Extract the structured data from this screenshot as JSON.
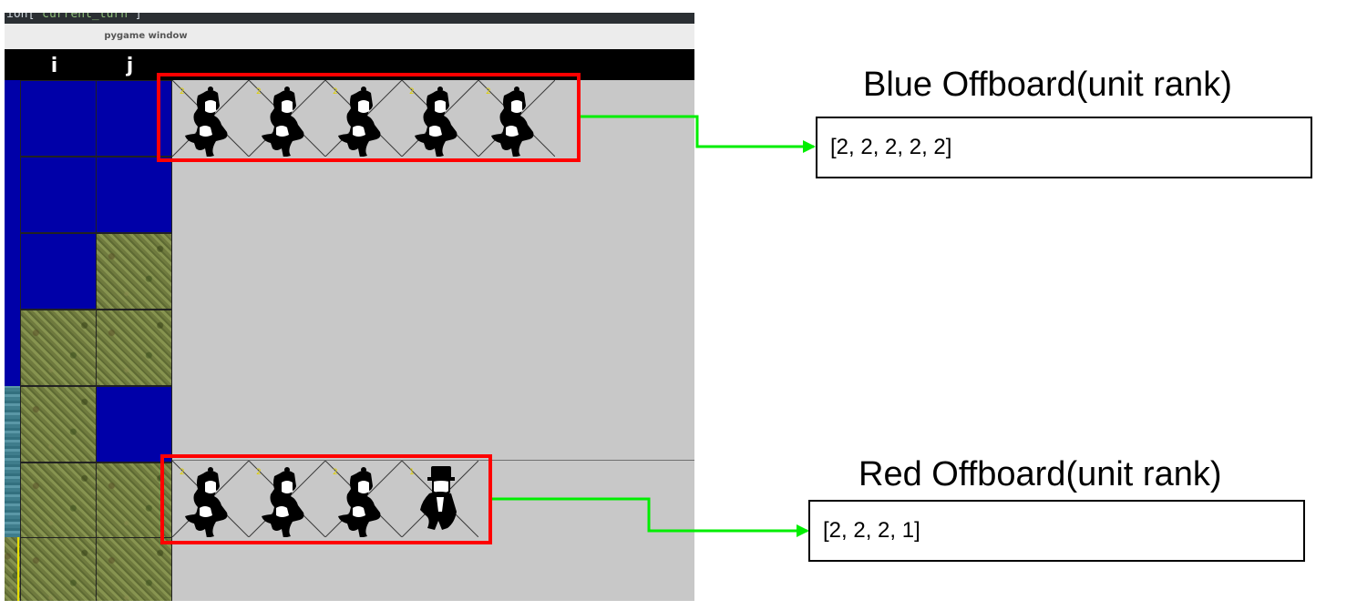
{
  "code_snippet": {
    "prefix": "ion[",
    "string": "'current_turn'",
    "suffix": "]"
  },
  "window": {
    "title": "pygame window"
  },
  "board": {
    "column_labels": [
      "i",
      "j"
    ],
    "blue_offboard_ranks": [
      "2",
      "2",
      "2",
      "2",
      "2"
    ],
    "red_offboard_ranks": [
      "2",
      "2",
      "2",
      "1"
    ],
    "blue_unit_icons": [
      "infantry-icon",
      "infantry-icon",
      "infantry-icon",
      "infantry-icon",
      "infantry-icon"
    ],
    "red_unit_icons": [
      "infantry-icon",
      "infantry-icon",
      "infantry-icon",
      "officer-icon"
    ]
  },
  "annotations": {
    "blue": {
      "title": "Blue Offboard(unit rank)",
      "value": "[2, 2, 2, 2, 2]"
    },
    "red": {
      "title": "Red Offboard(unit rank)",
      "value": "[2, 2, 2, 1]"
    }
  },
  "colors": {
    "highlight": "#ff0000",
    "arrow": "#00ee00",
    "water": "#0000a8",
    "offboard_background": "#c8c8c8"
  }
}
